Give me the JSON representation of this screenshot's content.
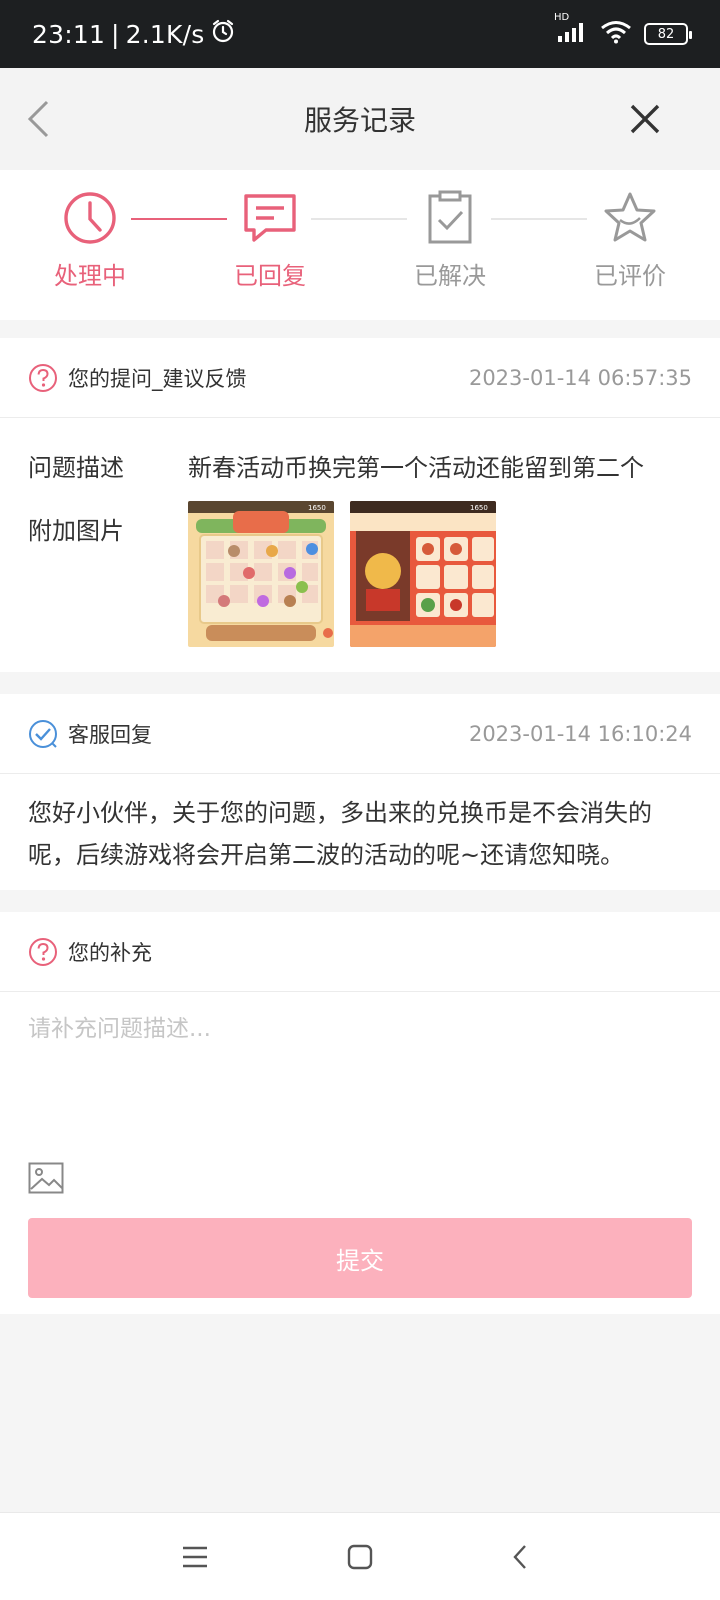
{
  "status_bar": {
    "time": "23:11",
    "separator": "|",
    "net_speed": "2.1K/s",
    "battery": "82",
    "hd_label": "HD"
  },
  "header": {
    "title": "服务记录"
  },
  "steps": [
    {
      "label": "处理中",
      "icon": "clock-icon",
      "state": "active"
    },
    {
      "label": "已回复",
      "icon": "message-icon",
      "state": "active"
    },
    {
      "label": "已解决",
      "icon": "clipboard-check-icon",
      "state": "inactive"
    },
    {
      "label": "已评价",
      "icon": "star-icon",
      "state": "inactive"
    }
  ],
  "question": {
    "label": "您的提问_建议反馈",
    "time": "2023-01-14 06:57:35",
    "desc_key": "问题描述",
    "desc_value": "新春活动币换完第一个活动还能留到第二个",
    "images_key": "附加图片",
    "thumb_badge": "1650"
  },
  "reply": {
    "label": "客服回复",
    "time": "2023-01-14 16:10:24",
    "text": "您好小伙伴，关于您的问题，多出来的兑换币是不会消失的呢，后续游戏将会开启第二波的活动的呢~还请您知晓。"
  },
  "supplement": {
    "label": "您的补充",
    "placeholder": "请补充问题描述...",
    "submit_label": "提交"
  },
  "colors": {
    "accent": "#e8617a",
    "inactive": "#999999",
    "submit_bg": "#fcb1bd",
    "reply_icon": "#4a90d9"
  }
}
